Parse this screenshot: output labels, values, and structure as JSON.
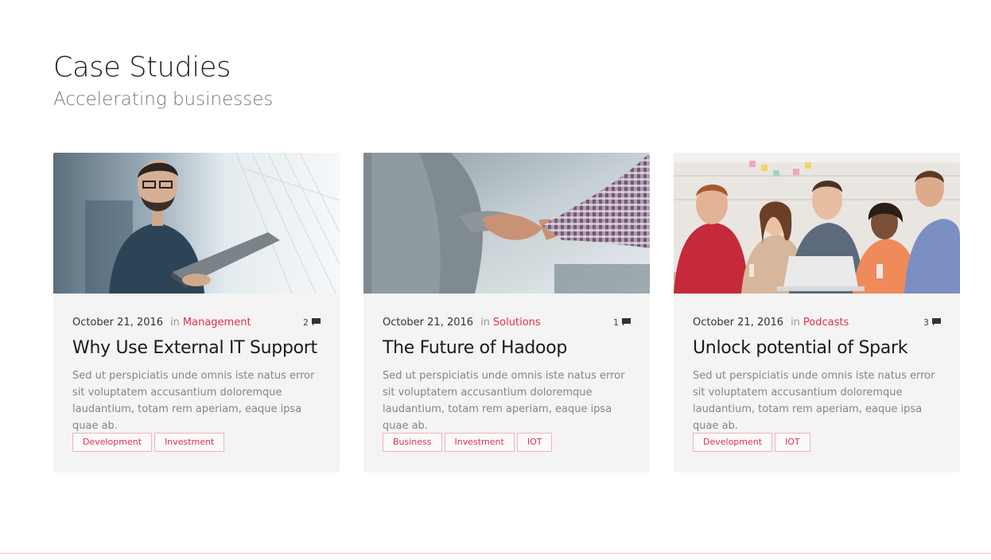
{
  "section": {
    "title": "Case Studies",
    "subtitle": "Accelerating businesses"
  },
  "cards": [
    {
      "image": "businessman-with-laptop-photo",
      "date": "October 21, 2016",
      "in_label": "in",
      "category": "Management",
      "comments": "2",
      "title": "Why Use External IT Support",
      "excerpt": "Sed ut perspiciatis unde omnis iste natus error sit voluptatem accusantium doloremque laudantium, totam rem aperiam, eaque ipsa quae ab.",
      "tags": [
        "Development",
        "Investment"
      ]
    },
    {
      "image": "handshake-photo",
      "date": "October 21, 2016",
      "in_label": "in",
      "category": "Solutions",
      "comments": "1",
      "title": "The Future of Hadoop",
      "excerpt": "Sed ut perspiciatis unde omnis iste natus error sit voluptatem accusantium doloremque laudantium, totam rem aperiam, eaque ipsa quae ab.",
      "tags": [
        "Business",
        "Investment",
        "IOT"
      ]
    },
    {
      "image": "team-meeting-photo",
      "date": "October 21, 2016",
      "in_label": "in",
      "category": "Podcasts",
      "comments": "3",
      "title": "Unlock potential of Spark",
      "excerpt": "Sed ut perspiciatis unde omnis iste natus error sit voluptatem accusantium doloremque laudantium, totam rem aperiam, eaque ipsa quae ab.",
      "tags": [
        "Development",
        "IOT"
      ]
    }
  ],
  "colors": {
    "accent": "#e0304a",
    "card_background": "#f4f4f4",
    "muted_text": "#858585"
  }
}
